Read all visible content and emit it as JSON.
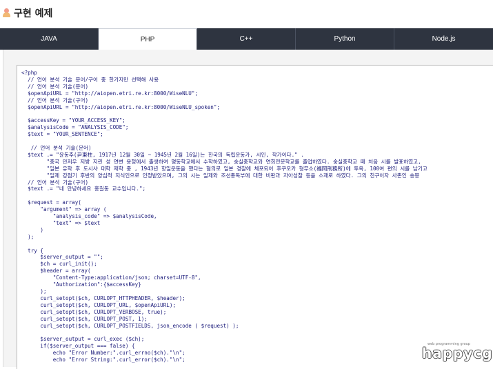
{
  "page": {
    "title": "구현 예제"
  },
  "tabs": [
    {
      "label": "JAVA",
      "active": false
    },
    {
      "label": "PHP",
      "active": true
    },
    {
      "label": "C++",
      "active": false
    },
    {
      "label": "Python",
      "active": false
    },
    {
      "label": "Node.js",
      "active": false
    }
  ],
  "code": [
    "<?php",
    "  // 언어 분석 기술 문어/구어 중 한가지만 선택해 사용",
    "  // 언어 분석 기술(문어)",
    "  $openApiURL = \"http://aiopen.etri.re.kr:8000/WiseNLU\";",
    "  // 언어 분석 기술(구어)",
    "  $openApiURL = \"http://aiopen.etri.re.kr:8000/WiseNLU_spoken\";",
    "",
    "  $accessKey = \"YOUR_ACCESS_KEY\";",
    "  $analysisCode = \"ANALYSIS_CODE\";",
    "  $text = \"YOUR_SENTENCE\";",
    "",
    "   // 언어 분석 기술(문어)",
    "  $text .= \"윤동주(尹東柱, 1917년 12월 30일 ~ 1945년 2월 16일)는 한국의 독립운동가, 시인, 작가이다.\" .",
    "        \"중국 만저우 지방 지린 성 연변 용정에서 출생하여 명동학교에서 수학하였고, 숭실중학교와 연희전문학교를 졸업하였다. 숭실중학교 때 처음 시를 발표하였고,",
    "        \"일본 유학 후 도시샤 대학 재학 중 , 1943년 항일운동을 했다는 혐의로 일본 경찰에 체포되어 후쿠오카 형무소(福岡刑務所)에 투옥, 100여 편의 시를 남기고",
    "        \"일제 강점기 후반의 양심적 지식인으로 인정받았으며, 그의 시는 일제와 조선총독부에 대한 비판과 자아성찰 등을 소재로 하였다. 그의 친구이자 사촌인 송몽",
    "  // 언어 분석 기술(구어)",
    "  $text .= \"네 안녕하세요 홍길동 교수입니다.\";",
    "",
    "  $request = array(",
    "      \"argument\" => array (",
    "          \"analysis_code\" => $analysisCode,",
    "          \"text\" => $text",
    "      )",
    "  );",
    "",
    "  try {",
    "      $server_output = \"\";",
    "      $ch = curl_init();",
    "      $header = array(",
    "          \"Content-Type:application/json; charset=UTF-8\",",
    "          \"Authorization\":{$accessKey}",
    "      );",
    "      curl_setopt($ch, CURLOPT_HTTPHEADER, $header);",
    "      curl_setopt($ch, CURLOPT_URL, $openApiURL);",
    "      curl_setopt($ch, CURLOPT_VERBOSE, true);",
    "      curl_setopt($ch, CURLOPT_POST, 1);",
    "      curl_setopt($ch, CURLOPT_POSTFIELDS, json_encode ( $request) );",
    "",
    "      $server_output = curl_exec ($ch);",
    "      if($server_output === false) {",
    "          echo \"Error Number:\".curl_errno($ch).\"\\n\";",
    "          echo \"Error String:\".curl_error($ch).\"\\n\";"
  ],
  "watermark": {
    "small": "web programming group",
    "main": "happycgi"
  }
}
